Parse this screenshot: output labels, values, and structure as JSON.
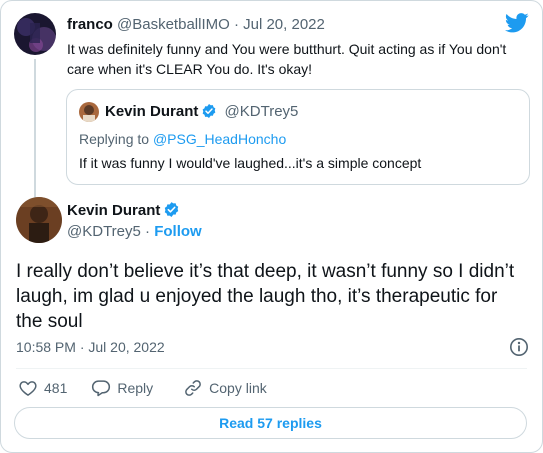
{
  "parent_tweet": {
    "author_name": "franco",
    "author_handle": "@BasketballIMO",
    "separator": "·",
    "date": "Jul 20, 2022",
    "text": "It was definitely funny and You were butthurt. Quit acting as if You don't care when it's CLEAR You do. It's okay!"
  },
  "quoted_tweet": {
    "author_name": "Kevin Durant",
    "author_handle": "@KDTrey5",
    "replying_label": "Replying to",
    "replying_handle": "@PSG_HeadHoncho",
    "text": "If it was funny I would've laughed...it's a simple concept"
  },
  "main_tweet": {
    "author_name": "Kevin Durant",
    "author_handle": "@KDTrey5",
    "separator": "·",
    "follow_label": "Follow",
    "text": "I really don’t believe it’s that deep, it wasn’t funny so I didn’t laugh, im glad u enjoyed the laugh tho, it’s therapeutic for the soul",
    "timestamp": "10:58 PM · Jul 20, 2022"
  },
  "actions": {
    "like_count": "481",
    "reply_label": "Reply",
    "copy_link_label": "Copy link"
  },
  "read_replies_label": "Read 57 replies",
  "icons": [
    "twitter-bird-icon",
    "verified-badge-icon",
    "info-icon",
    "heart-icon",
    "reply-icon",
    "link-icon"
  ],
  "colors": {
    "accent": "#1d9bf0",
    "text": "#0f1419",
    "muted": "#536471",
    "border": "#cfd9de"
  }
}
